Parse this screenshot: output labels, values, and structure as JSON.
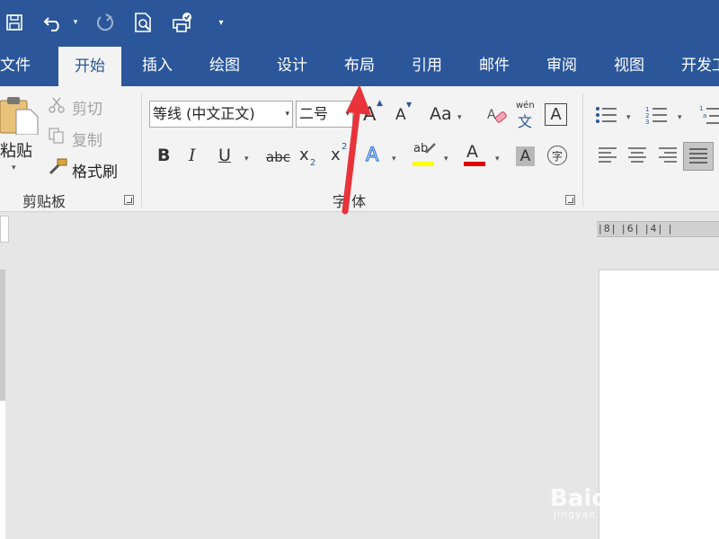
{
  "tabs": {
    "file": "文件",
    "home": "开始",
    "insert": "插入",
    "draw": "绘图",
    "design": "设计",
    "layout": "布局",
    "references": "引用",
    "mailings": "邮件",
    "review": "审阅",
    "view": "视图",
    "developer": "开发工"
  },
  "clipboard": {
    "paste": "粘贴",
    "cut": "剪切",
    "copy": "复制",
    "format_painter": "格式刷",
    "group_label": "剪贴板"
  },
  "font": {
    "font_name": "等线 (中文正文)",
    "font_size": "二号",
    "change_case": "Aa",
    "phonetic_top": "wén",
    "phonetic_bottom": "文",
    "char_border": "A",
    "grow": "A",
    "shrink": "A",
    "bold": "B",
    "italic": "I",
    "underline": "U",
    "strike": "abc",
    "subscript_base": "x",
    "subscript_mark": "2",
    "superscript_base": "x",
    "superscript_mark": "2",
    "text_effects": "A",
    "highlight": "ab",
    "font_color": "A",
    "char_shading": "A",
    "enclose": "字",
    "group_label": "字 体"
  },
  "ruler": {
    "marks": "|8| |6| |4| |"
  },
  "watermark": {
    "brand": "Baidu经验",
    "url": "jingyan.baidu.com"
  },
  "colors": {
    "accent": "#2b579a",
    "highlight_yellow": "#ffff00",
    "font_red": "#e00000",
    "annotation_arrow": "#e8333a"
  },
  "icons": {
    "save": "save-icon",
    "undo": "undo-icon",
    "redo": "redo-icon",
    "print_preview": "print-preview-icon",
    "quick_print": "quick-print-icon",
    "customize": "customize-qat-icon"
  }
}
